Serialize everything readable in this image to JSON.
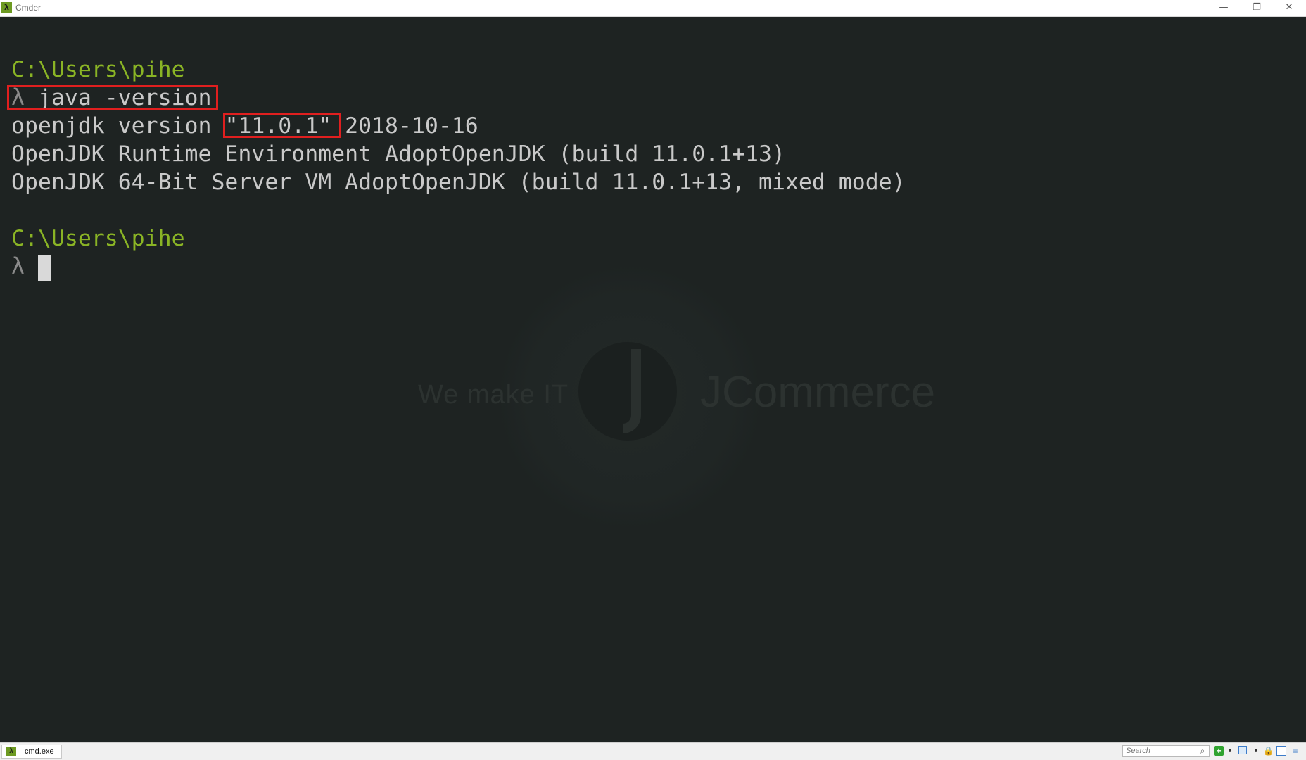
{
  "window": {
    "title": "Cmder",
    "app_icon": "λ",
    "controls": {
      "minimize": "—",
      "restore": "❐",
      "close": "✕"
    }
  },
  "terminal": {
    "blocks": [
      {
        "path": "C:\\Users\\pihe",
        "prompt": "λ",
        "command": "java -version"
      },
      {
        "path": "C:\\Users\\pihe",
        "prompt": "λ",
        "command": ""
      }
    ],
    "output": {
      "version_prefix": "openjdk version ",
      "version_value": "\"11.0.1\"",
      "version_date": "2018-10-16",
      "runtime": "OpenJDK Runtime Environment AdoptOpenJDK (build 11.0.1+13)",
      "vm": "OpenJDK 64-Bit Server VM AdoptOpenJDK (build 11.0.1+13, mixed mode)"
    },
    "colors": {
      "path": "#8ab425",
      "text": "#c9c9c9",
      "background": "#1e2322",
      "highlight": "#e01f1f"
    }
  },
  "watermark": {
    "slogan": "We make IT",
    "brand": "JCommerce"
  },
  "statusbar": {
    "tab_icon": "λ",
    "tab_label": "cmd.exe",
    "search_placeholder": "Search",
    "icons": [
      "search-icon",
      "new-console-icon",
      "split-icon",
      "lock-icon",
      "panel-icon",
      "menu-icon"
    ]
  }
}
